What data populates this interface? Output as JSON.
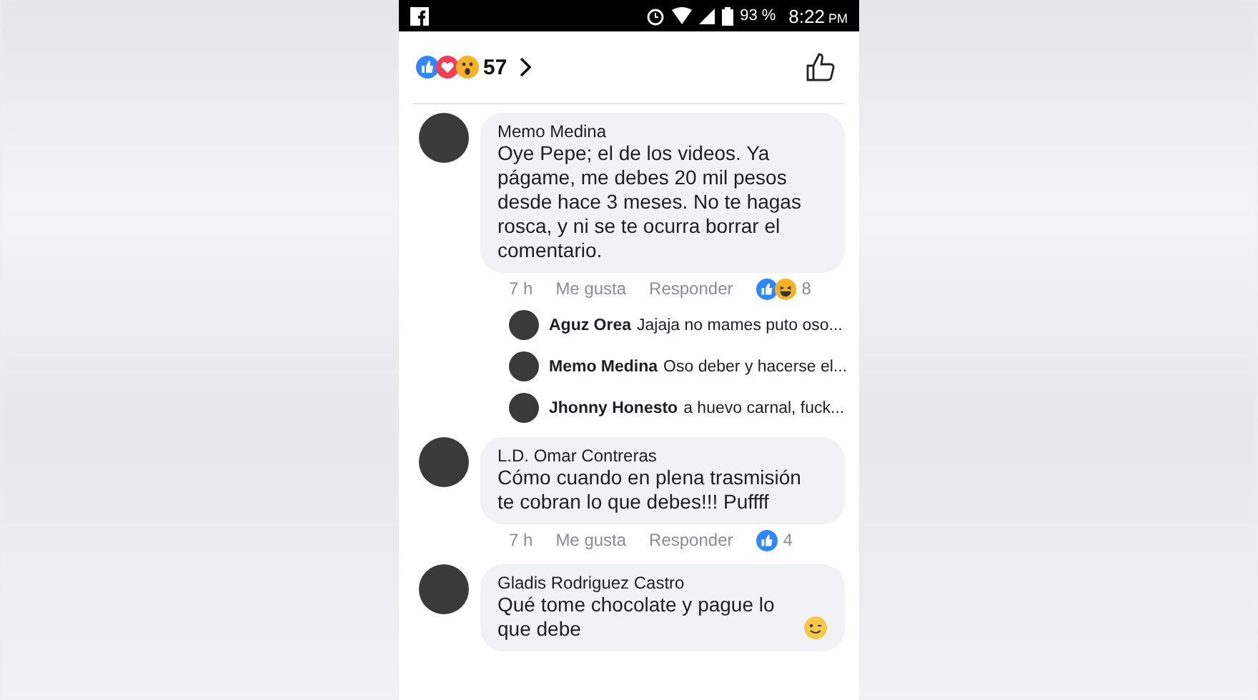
{
  "status_bar": {
    "battery": "93 %",
    "time": "8:22",
    "ampm": "PM"
  },
  "reactions_summary": {
    "reactions": [
      {
        "kind": "like"
      },
      {
        "kind": "love"
      },
      {
        "kind": "wow"
      }
    ],
    "count": "57"
  },
  "comments": [
    {
      "author": "Memo Medina",
      "text": "Oye Pepe; el de los videos. Ya págame, me debes 20 mil pesos desde hace 3 meses. No te hagas rosca, y ni se te ocurra borrar el comentario.",
      "time": "7 h",
      "like_label": "Me gusta",
      "reply_label": "Responder",
      "reactions": [
        {
          "kind": "like"
        },
        {
          "kind": "haha"
        }
      ],
      "reaction_count": "8",
      "replies": [
        {
          "author": "Aguz Orea",
          "text": "Jajaja no mames puto oso..."
        },
        {
          "author": "Memo Medina",
          "text": "Oso deber y hacerse el..."
        },
        {
          "author": "Jhonny Honesto",
          "text": "a huevo carnal, fuck..."
        }
      ]
    },
    {
      "author": "L.D. Omar Contreras",
      "text": "Cómo cuando en plena trasmisión te cobran lo que debes!!! Puffff",
      "time": "7 h",
      "like_label": "Me gusta",
      "reply_label": "Responder",
      "reactions": [
        {
          "kind": "like"
        }
      ],
      "reaction_count": "4"
    },
    {
      "author": "Gladis Rodriguez Castro",
      "text": "Qué tome chocolate y pague lo que debe",
      "emoji": {
        "kind": "wink"
      }
    }
  ]
}
